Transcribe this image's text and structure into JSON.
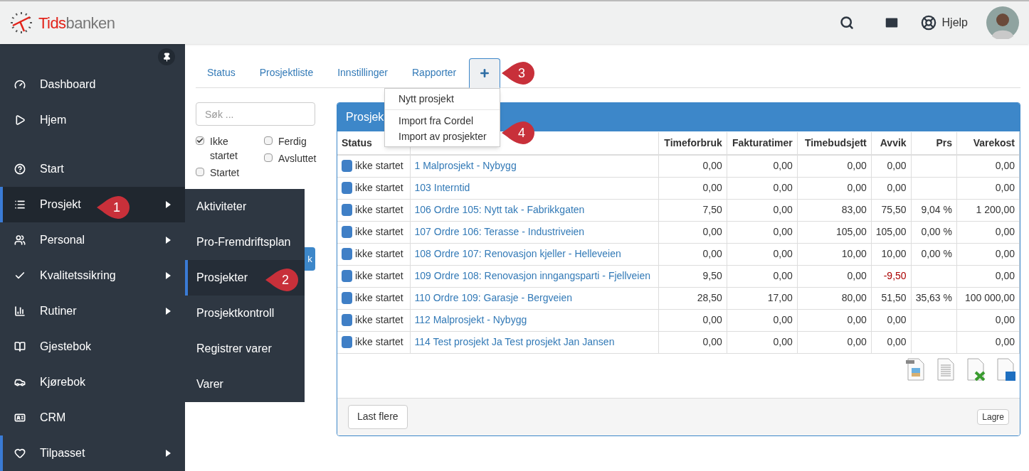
{
  "header": {
    "logo": {
      "accent": "Tids",
      "rest": "banken"
    },
    "help": "Hjelp"
  },
  "sidebar": {
    "items": [
      {
        "label": "Dashboard",
        "selected": false,
        "marked": false,
        "submenu": false
      },
      {
        "label": "Hjem",
        "selected": false,
        "marked": false,
        "submenu": false
      },
      {
        "label": "Start",
        "selected": false,
        "marked": false,
        "submenu": false
      },
      {
        "label": "Prosjekt",
        "selected": true,
        "marked": true,
        "submenu": true
      },
      {
        "label": "Personal",
        "selected": false,
        "marked": false,
        "submenu": true
      },
      {
        "label": "Kvalitetssikring",
        "selected": false,
        "marked": false,
        "submenu": true
      },
      {
        "label": "Rutiner",
        "selected": false,
        "marked": false,
        "submenu": true
      },
      {
        "label": "Gjestebok",
        "selected": false,
        "marked": false,
        "submenu": false
      },
      {
        "label": "Kjørebok",
        "selected": false,
        "marked": false,
        "submenu": false
      },
      {
        "label": "CRM",
        "selected": false,
        "marked": false,
        "submenu": false
      },
      {
        "label": "Tilpasset",
        "selected": false,
        "marked": true,
        "submenu": true
      }
    ]
  },
  "submenu": {
    "items": [
      {
        "label": "Aktiviteter",
        "selected": false
      },
      {
        "label": "Pro-Fremdriftsplan",
        "selected": false
      },
      {
        "label": "Prosjekter",
        "selected": true
      },
      {
        "label": "Prosjektkontroll",
        "selected": false
      },
      {
        "label": "Registrer varer",
        "selected": false
      },
      {
        "label": "Varer",
        "selected": false
      }
    ]
  },
  "tabs": [
    {
      "kind": "text",
      "label": "Status",
      "selected": false
    },
    {
      "kind": "text",
      "label": "Prosjektliste",
      "selected": false
    },
    {
      "kind": "text",
      "label": "Innstillinger",
      "selected": false
    },
    {
      "kind": "text",
      "label": "Rapporter",
      "selected": false
    },
    {
      "kind": "add",
      "selected": true
    }
  ],
  "add_menu": {
    "groups": [
      [
        "Nytt prosjekt"
      ],
      [
        "Import fra Cordel",
        "Import av prosjekter"
      ]
    ]
  },
  "filter": {
    "search": {
      "placeholder": "Søk ..."
    },
    "checkboxes": [
      {
        "label": "Ikke startet",
        "checked": true
      },
      {
        "label": "Startet",
        "checked": false
      },
      {
        "label": "Ferdig",
        "checked": false
      },
      {
        "label": "Avsluttet",
        "checked": false
      }
    ],
    "button": "k"
  },
  "panel": {
    "title": "Prosjek",
    "columns": [
      "Status",
      "Timeforbruk",
      "Fakturatimer",
      "Timebudsjett",
      "Avvik",
      "Prs",
      "Varekost"
    ],
    "rows": [
      {
        "status": "ikke startet",
        "name": "1 Malprosjekt - Nybygg",
        "timeforbruk": "0,00",
        "fakturatimer": "0,00",
        "timebudsjett": "0,00",
        "avvik": "0,00",
        "avvik_negative": false,
        "varekost": "0,00"
      },
      {
        "status": "ikke startet",
        "name": "103 Interntid",
        "timeforbruk": "0,00",
        "fakturatimer": "0,00",
        "timebudsjett": "0,00",
        "avvik": "0,00",
        "avvik_negative": false,
        "varekost": "0,00"
      },
      {
        "status": "ikke startet",
        "name": "106 Ordre 105: Nytt tak - Fabrikkgaten",
        "timeforbruk": "7,50",
        "fakturatimer": "0,00",
        "timebudsjett": "83,00",
        "avvik": "75,50",
        "avvik_negative": false,
        "prs": "9,04 %",
        "varekost": "1 200,00"
      },
      {
        "status": "ikke startet",
        "name": "107 Ordre 106: Terasse - Industriveien",
        "timeforbruk": "0,00",
        "fakturatimer": "0,00",
        "timebudsjett": "105,00",
        "avvik": "105,00",
        "avvik_negative": false,
        "prs": "0,00 %",
        "varekost": "0,00"
      },
      {
        "status": "ikke startet",
        "name": "108 Ordre 107: Renovasjon kjeller - Helleveien",
        "timeforbruk": "0,00",
        "fakturatimer": "0,00",
        "timebudsjett": "10,00",
        "avvik": "10,00",
        "avvik_negative": false,
        "prs": "0,00 %",
        "varekost": "0,00"
      },
      {
        "status": "ikke startet",
        "name": "109 Ordre 108: Renovasjon inngangsparti - Fjellveien",
        "timeforbruk": "9,50",
        "fakturatimer": "0,00",
        "timebudsjett": "0,00",
        "avvik": "-9,50",
        "avvik_negative": true,
        "varekost": "0,00"
      },
      {
        "status": "ikke startet",
        "name": "110 Ordre 109: Garasje - Bergveien",
        "timeforbruk": "28,50",
        "fakturatimer": "17,00",
        "timebudsjett": "80,00",
        "avvik": "51,50",
        "avvik_negative": false,
        "prs": "35,63 %",
        "varekost": "100 000,00"
      },
      {
        "status": "ikke startet",
        "name": "112 Malprosjekt - Nybygg",
        "timeforbruk": "0,00",
        "fakturatimer": "0,00",
        "timebudsjett": "0,00",
        "avvik": "0,00",
        "avvik_negative": false,
        "varekost": "0,00"
      },
      {
        "status": "ikke startet",
        "name": "114 Test prosjekt Ja Test prosjekt Jan Jansen",
        "timeforbruk": "0,00",
        "fakturatimer": "0,00",
        "timebudsjett": "0,00",
        "avvik": "0,00",
        "avvik_negative": false,
        "varekost": "0,00"
      }
    ],
    "load_more": "Last flere",
    "save": "Lagre"
  },
  "callouts": [
    "1",
    "2",
    "3",
    "4"
  ]
}
